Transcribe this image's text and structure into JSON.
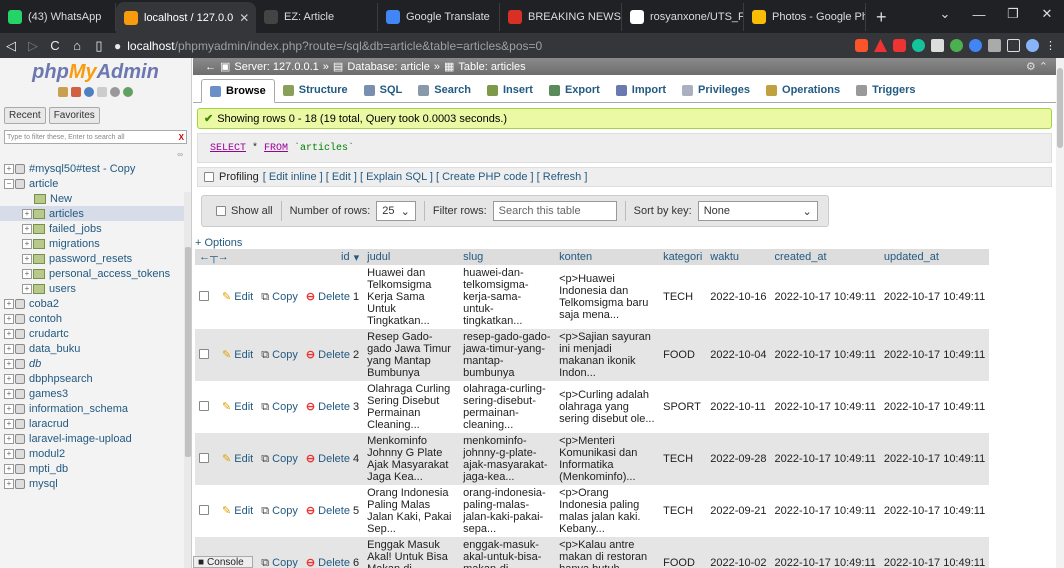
{
  "browser": {
    "tabs": [
      {
        "label": "(43) WhatsApp",
        "icon": "whatsapp-icon",
        "color": "#25d366"
      },
      {
        "label": "localhost / 127.0.0",
        "icon": "phpmyadmin-icon",
        "color": "#f89c0e",
        "active": true
      },
      {
        "label": "EZ: Article",
        "icon": "ez-icon",
        "color": "#444"
      },
      {
        "label": "Google Translate",
        "icon": "translate-icon",
        "color": "#4285f4"
      },
      {
        "label": "BREAKING NEWS: Indo",
        "icon": "news-icon",
        "color": "#d93025"
      },
      {
        "label": "rosyanxone/UTS_Fram",
        "icon": "github-icon",
        "color": "#fff"
      },
      {
        "label": "Photos - Google Photo",
        "icon": "photos-icon",
        "color": "#fbbc04"
      }
    ],
    "url_host": "localhost",
    "url_path": "/phpmyadmin/index.php?route=/sql&db=article&table=articles&pos=0"
  },
  "sidebar": {
    "logo_php": "php",
    "logo_my": "My",
    "logo_admin": "Admin",
    "recent_label": "Recent",
    "favorites_label": "Favorites",
    "filter_placeholder": "Type to filter these, Enter to search all",
    "filter_clear": "X",
    "tree": [
      {
        "label": "#mysql50#test - Copy",
        "type": "db"
      },
      {
        "label": "article",
        "type": "db",
        "open": true
      },
      {
        "label": "New",
        "type": "new",
        "indent": 1
      },
      {
        "label": "articles",
        "type": "table",
        "indent": 1,
        "selected": true
      },
      {
        "label": "failed_jobs",
        "type": "table",
        "indent": 1
      },
      {
        "label": "migrations",
        "type": "table",
        "indent": 1
      },
      {
        "label": "password_resets",
        "type": "table",
        "indent": 1
      },
      {
        "label": "personal_access_tokens",
        "type": "table",
        "indent": 1
      },
      {
        "label": "users",
        "type": "table",
        "indent": 1
      },
      {
        "label": "coba2",
        "type": "db"
      },
      {
        "label": "contoh",
        "type": "db"
      },
      {
        "label": "crudartc",
        "type": "db"
      },
      {
        "label": "data_buku",
        "type": "db"
      },
      {
        "label": "db",
        "type": "db",
        "italic": true
      },
      {
        "label": "dbphpsearch",
        "type": "db"
      },
      {
        "label": "games3",
        "type": "db"
      },
      {
        "label": "information_schema",
        "type": "db"
      },
      {
        "label": "laracrud",
        "type": "db"
      },
      {
        "label": "laravel-image-upload",
        "type": "db"
      },
      {
        "label": "modul2",
        "type": "db"
      },
      {
        "label": "mpti_db",
        "type": "db"
      },
      {
        "label": "mysql",
        "type": "db"
      }
    ]
  },
  "breadcrumb": {
    "server": "Server: 127.0.0.1",
    "database": "Database: article",
    "table": "Table: articles"
  },
  "menu_tabs": [
    {
      "label": "Browse",
      "active": true,
      "color": "#6b8fc7"
    },
    {
      "label": "Structure",
      "color": "#8aa05a"
    },
    {
      "label": "SQL",
      "color": "#7a8fb0"
    },
    {
      "label": "Search",
      "color": "#8899aa"
    },
    {
      "label": "Insert",
      "color": "#7c9a4a"
    },
    {
      "label": "Export",
      "color": "#5b8a5b"
    },
    {
      "label": "Import",
      "color": "#6a7ab0"
    },
    {
      "label": "Privileges",
      "color": "#aab0c0"
    },
    {
      "label": "Operations",
      "color": "#c0a040"
    },
    {
      "label": "Triggers",
      "color": "#999"
    }
  ],
  "success_message": "Showing rows 0 - 18 (19 total, Query took 0.0003 seconds.)",
  "sql": {
    "select": "SELECT",
    "star": " * ",
    "from": "FROM",
    "table": " `articles`"
  },
  "profiling": {
    "label": "Profiling",
    "links": "[ Edit inline ] [ Edit ] [ Explain SQL ] [ Create PHP code ] [ Refresh ]"
  },
  "nav": {
    "show_all": "Show all",
    "rows_label": "Number of rows:",
    "rows_value": "25",
    "filter_label": "Filter rows:",
    "filter_placeholder": "Search this table",
    "sort_label": "Sort by key:",
    "sort_value": "None"
  },
  "options_label": "+ Options",
  "columns": [
    "id",
    "judul",
    "slug",
    "konten",
    "kategori",
    "waktu",
    "created_at",
    "updated_at"
  ],
  "row_actions": {
    "edit": "Edit",
    "copy": "Copy",
    "delete": "Delete"
  },
  "rows": [
    {
      "id": "1",
      "judul": "Huawei dan Telkomsigma Kerja Sama Untuk Tingkatkan...",
      "slug": "huawei-dan-telkomsigma-kerja-sama-untuk-tingkatkan...",
      "konten": "<p>Huawei Indonesia dan Telkomsigma baru saja mena...",
      "kategori": "TECH",
      "waktu": "2022-10-16",
      "created_at": "2022-10-17 10:49:11",
      "updated_at": "2022-10-17 10:49:11"
    },
    {
      "id": "2",
      "judul": "Resep Gado-gado Jawa Timur yang Mantap Bumbunya",
      "slug": "resep-gado-gado-jawa-timur-yang-mantap-bumbunya",
      "konten": "<p>Sajian sayuran ini menjadi makanan ikonik Indon...",
      "kategori": "FOOD",
      "waktu": "2022-10-04",
      "created_at": "2022-10-17 10:49:11",
      "updated_at": "2022-10-17 10:49:11"
    },
    {
      "id": "3",
      "judul": "Olahraga Curling Sering Disebut Permainan Cleaning...",
      "slug": "olahraga-curling-sering-disebut-permainan-cleaning...",
      "konten": "<p>Curling adalah olahraga yang sering disebut ole...",
      "kategori": "SPORT",
      "waktu": "2022-10-11",
      "created_at": "2022-10-17 10:49:11",
      "updated_at": "2022-10-17 10:49:11"
    },
    {
      "id": "4",
      "judul": "Menkominfo Johnny G Plate Ajak Masyarakat Jaga Kea...",
      "slug": "menkominfo-johnny-g-plate-ajak-masyarakat-jaga-kea...",
      "konten": "<p>Menteri Komunikasi dan Informatika (Menkominfo)...",
      "kategori": "TECH",
      "waktu": "2022-09-28",
      "created_at": "2022-10-17 10:49:11",
      "updated_at": "2022-10-17 10:49:11"
    },
    {
      "id": "5",
      "judul": "Orang Indonesia Paling Malas Jalan Kaki, Pakai Sep...",
      "slug": "orang-indonesia-paling-malas-jalan-kaki-pakai-sepa...",
      "konten": "<p>Orang Indonesia paling malas jalan kaki. Kebany...",
      "kategori": "TECH",
      "waktu": "2022-09-21",
      "created_at": "2022-10-17 10:49:11",
      "updated_at": "2022-10-17 10:49:11"
    },
    {
      "id": "6",
      "judul": "Enggak Masuk Akal! Untuk Bisa Makan di Restoran In...",
      "slug": "enggak-masuk-akal-untuk-bisa-makan-di-restoran-ini...",
      "konten": "<p>Kalau antre makan di restoran hanya butuh waktu...",
      "kategori": "FOOD",
      "waktu": "2022-10-02",
      "created_at": "2022-10-17 10:49:11",
      "updated_at": "2022-10-17 10:49:11"
    }
  ],
  "console_label": "Console"
}
